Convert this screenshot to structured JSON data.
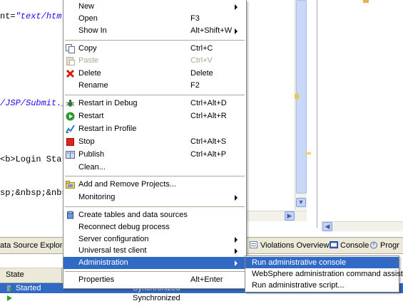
{
  "editor": {
    "lines": [
      {
        "pre": "nt=",
        "str": "\"text/html"
      },
      {
        "pre": "",
        "str": "/JSP/Submit._"
      },
      {
        "pre": "<b>Login Star",
        "str": ""
      },
      {
        "pre": "sp;&nbsp;&nbs",
        "str": ""
      }
    ]
  },
  "menu": {
    "items": [
      {
        "label": "New",
        "shortcut": "",
        "submenu": true,
        "icon": ""
      },
      {
        "label": "Open",
        "shortcut": "F3",
        "submenu": false,
        "icon": ""
      },
      {
        "label": "Show In",
        "shortcut": "Alt+Shift+W",
        "submenu": true,
        "icon": ""
      },
      {
        "label": "Copy",
        "shortcut": "Ctrl+C",
        "submenu": false,
        "icon": "copy-icon"
      },
      {
        "label": "Paste",
        "shortcut": "Ctrl+V",
        "submenu": false,
        "icon": "paste-icon",
        "disabled": true
      },
      {
        "label": "Delete",
        "shortcut": "Delete",
        "submenu": false,
        "icon": "delete-icon"
      },
      {
        "label": "Rename",
        "shortcut": "F2",
        "submenu": false,
        "icon": ""
      },
      {
        "label": "Restart in Debug",
        "shortcut": "Ctrl+Alt+D",
        "submenu": false,
        "icon": "debug-icon"
      },
      {
        "label": "Restart",
        "shortcut": "Ctrl+Alt+R",
        "submenu": false,
        "icon": "restart-icon"
      },
      {
        "label": "Restart in Profile",
        "shortcut": "",
        "submenu": false,
        "icon": "profile-icon"
      },
      {
        "label": "Stop",
        "shortcut": "Ctrl+Alt+S",
        "submenu": false,
        "icon": "stop-icon"
      },
      {
        "label": "Publish",
        "shortcut": "Ctrl+Alt+P",
        "submenu": false,
        "icon": "publish-icon"
      },
      {
        "label": "Clean...",
        "shortcut": "",
        "submenu": false,
        "icon": ""
      },
      {
        "label": "Add and Remove Projects...",
        "shortcut": "",
        "submenu": false,
        "icon": "projects-icon"
      },
      {
        "label": "Monitoring",
        "shortcut": "",
        "submenu": true,
        "icon": ""
      },
      {
        "label": "Create tables and data sources",
        "shortcut": "",
        "submenu": false,
        "icon": "database-icon"
      },
      {
        "label": "Reconnect debug process",
        "shortcut": "",
        "submenu": false,
        "icon": ""
      },
      {
        "label": "Server configuration",
        "shortcut": "",
        "submenu": true,
        "icon": ""
      },
      {
        "label": "Universal test client",
        "shortcut": "",
        "submenu": true,
        "icon": ""
      },
      {
        "label": "Administration",
        "shortcut": "",
        "submenu": true,
        "icon": "",
        "highlighted": true
      },
      {
        "label": "Properties",
        "shortcut": "Alt+Enter",
        "submenu": false,
        "icon": ""
      }
    ]
  },
  "submenu": {
    "items": [
      {
        "label": "Run administrative console",
        "highlighted": true
      },
      {
        "label": "WebSphere administration command assist"
      },
      {
        "label": "Run administrative script..."
      }
    ]
  },
  "tabs": {
    "data_source_explorer": "ata Source Explorer",
    "violations_overview": "Violations Overview",
    "console": "Console",
    "progress": "Progr"
  },
  "servers": {
    "column_state": "State",
    "rows": [
      {
        "state": "Started",
        "status": "Synchronized",
        "selected": true
      },
      {
        "state": "",
        "status": "Synchronized",
        "selected": false
      }
    ]
  },
  "colors": {
    "selection": "#316ac5",
    "menu_border": "#888888",
    "chrome": "#ece9d8"
  }
}
